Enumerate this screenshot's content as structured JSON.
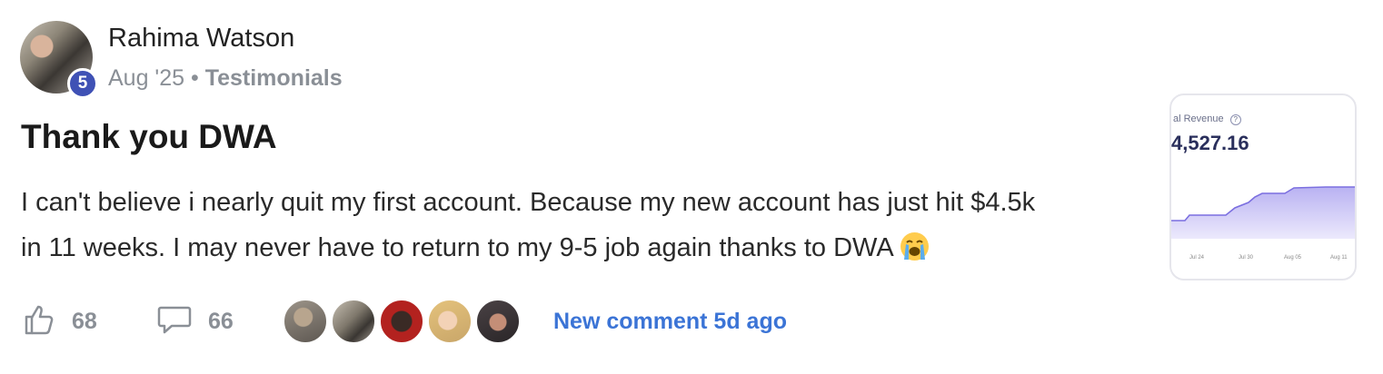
{
  "post": {
    "author": "Rahima Watson",
    "level": "5",
    "date": "Aug '25",
    "separator": "•",
    "category": "Testimonials",
    "title": "Thank you DWA",
    "body_line1": "I can't believe i nearly quit my first account. Because my new account has just hit $4.5k",
    "body_line2": "in 11 weeks. I may never have to return to my 9-5 job again thanks to DWA",
    "emoji": "loudly-crying-face-icon"
  },
  "attachment": {
    "label": "al Revenue",
    "value": "4,527.16",
    "x_ticks": [
      "Jul 24",
      "Jul 30",
      "Aug 05",
      "Aug 11"
    ]
  },
  "actions": {
    "likes": "68",
    "comments": "66",
    "new_comment": "New comment 5d ago"
  },
  "colors": {
    "accent": "#3b74d6",
    "level_badge": "#3f51b5",
    "muted": "#8a8f96",
    "chart_line": "#7b6fe0"
  }
}
